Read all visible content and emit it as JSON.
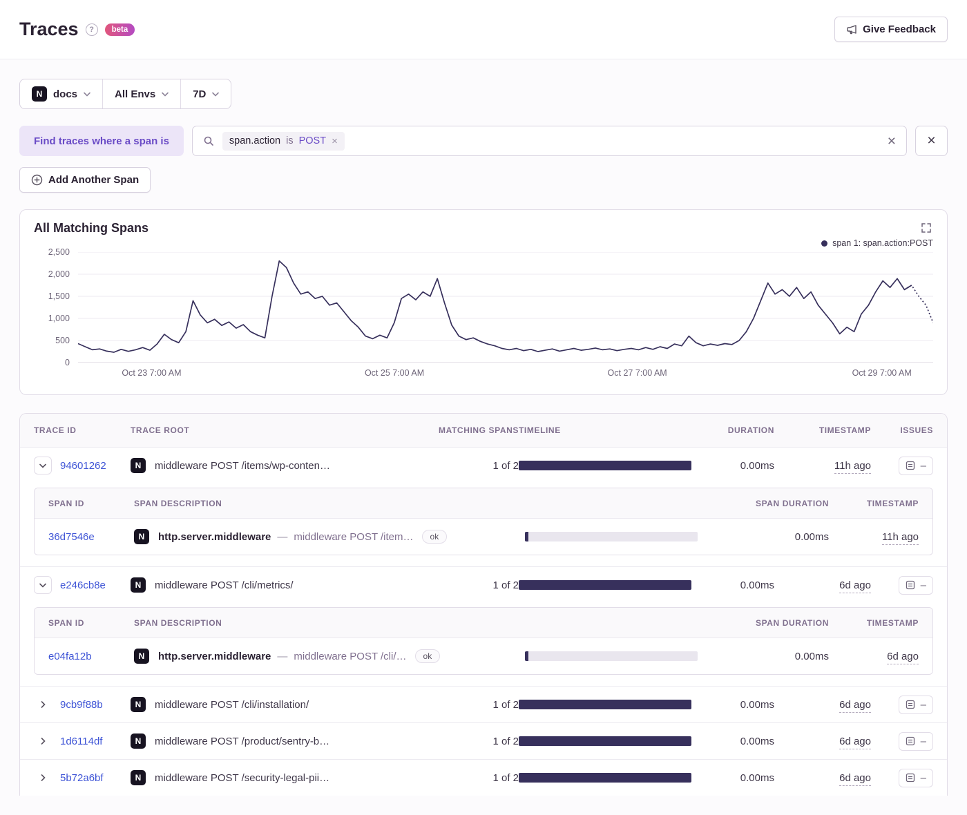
{
  "glyphs": {
    "project_logo": "N",
    "help": "?",
    "token_remove": "×",
    "search_clear": "×",
    "search_close": "×",
    "issues_empty": "–",
    "span_separator": "—"
  },
  "header": {
    "title": "Traces",
    "beta_badge": "beta",
    "feedback_label": "Give Feedback"
  },
  "filters": {
    "project": "docs",
    "environment": "All Envs",
    "date_range": "7D",
    "span_filter_label": "Find traces where a span is",
    "search_token": {
      "key": "span.action",
      "operator": "is",
      "value": "POST"
    },
    "add_span_label": "Add Another Span"
  },
  "chart": {
    "title": "All Matching Spans",
    "legend_label": "span 1: span.action:POST",
    "y_ticks": [
      "2,500",
      "2,000",
      "1,500",
      "1,000",
      "500",
      "0"
    ],
    "x_ticks": [
      "Oct 23 7:00 AM",
      "Oct 25 7:00 AM",
      "Oct 27 7:00 AM",
      "Oct 29 7:00 AM"
    ]
  },
  "chart_data": {
    "type": "line",
    "title": "All Matching Spans",
    "ylim": [
      0,
      2500
    ],
    "grid": true,
    "legend_position": "top-right",
    "x_tick_labels": [
      "Oct 23 7:00 AM",
      "Oct 25 7:00 AM",
      "Oct 27 7:00 AM",
      "Oct 29 7:00 AM"
    ],
    "x_tick_positions": [
      0.086,
      0.37,
      0.654,
      0.94
    ],
    "line_color": "#37305c",
    "dashed_tail_points": 4,
    "series": [
      {
        "name": "span 1: span.action:POST",
        "values": [
          430,
          360,
          290,
          310,
          260,
          235,
          300,
          255,
          290,
          340,
          280,
          420,
          640,
          520,
          450,
          700,
          1400,
          1080,
          900,
          980,
          840,
          920,
          780,
          860,
          700,
          620,
          560,
          1500,
          2300,
          2150,
          1800,
          1550,
          1600,
          1450,
          1500,
          1300,
          1350,
          1150,
          950,
          800,
          600,
          540,
          620,
          560,
          900,
          1450,
          1550,
          1420,
          1600,
          1500,
          1900,
          1350,
          850,
          600,
          520,
          560,
          480,
          420,
          380,
          320,
          290,
          320,
          270,
          300,
          250,
          280,
          310,
          260,
          290,
          320,
          280,
          300,
          330,
          290,
          310,
          270,
          300,
          320,
          290,
          340,
          300,
          360,
          320,
          420,
          380,
          600,
          450,
          380,
          420,
          390,
          430,
          410,
          500,
          700,
          1000,
          1400,
          1800,
          1550,
          1650,
          1500,
          1700,
          1450,
          1600,
          1300,
          1100,
          900,
          650,
          800,
          700,
          1100,
          1300,
          1600,
          1850,
          1700,
          1900,
          1650,
          1750,
          1500,
          1300,
          900
        ]
      }
    ]
  },
  "table": {
    "columns": {
      "trace_id": "TRACE ID",
      "trace_root": "TRACE ROOT",
      "matching_spans": "MATCHING SPANS",
      "timeline": "TIMELINE",
      "duration": "DURATION",
      "timestamp": "TIMESTAMP",
      "issues": "ISSUES"
    },
    "span_columns": {
      "span_id": "SPAN ID",
      "span_description": "SPAN DESCRIPTION",
      "span_duration": "SPAN DURATION",
      "timestamp": "TIMESTAMP"
    },
    "rows": [
      {
        "trace_id": "94601262",
        "trace_root": "middleware POST /items/wp-conten…",
        "matching_spans": "1 of 2",
        "duration": "0.00ms",
        "timestamp": "11h ago",
        "expanded": true,
        "spans": [
          {
            "span_id": "36d7546e",
            "op": "http.server.middleware",
            "description": "middleware POST /item…",
            "status": "ok",
            "duration": "0.00ms",
            "timestamp": "11h ago"
          }
        ]
      },
      {
        "trace_id": "e246cb8e",
        "trace_root": "middleware POST /cli/metrics/",
        "matching_spans": "1 of 2",
        "duration": "0.00ms",
        "timestamp": "6d ago",
        "expanded": true,
        "spans": [
          {
            "span_id": "e04fa12b",
            "op": "http.server.middleware",
            "description": "middleware POST /cli/…",
            "status": "ok",
            "duration": "0.00ms",
            "timestamp": "6d ago"
          }
        ]
      },
      {
        "trace_id": "9cb9f88b",
        "trace_root": "middleware POST /cli/installation/",
        "matching_spans": "1 of 2",
        "duration": "0.00ms",
        "timestamp": "6d ago",
        "expanded": false
      },
      {
        "trace_id": "1d6114df",
        "trace_root": "middleware POST /product/sentry-b…",
        "matching_spans": "1 of 2",
        "duration": "0.00ms",
        "timestamp": "6d ago",
        "expanded": false
      },
      {
        "trace_id": "5b72a6bf",
        "trace_root": "middleware POST /security-legal-pii…",
        "matching_spans": "1 of 2",
        "duration": "0.00ms",
        "timestamp": "6d ago",
        "expanded": false
      }
    ]
  }
}
